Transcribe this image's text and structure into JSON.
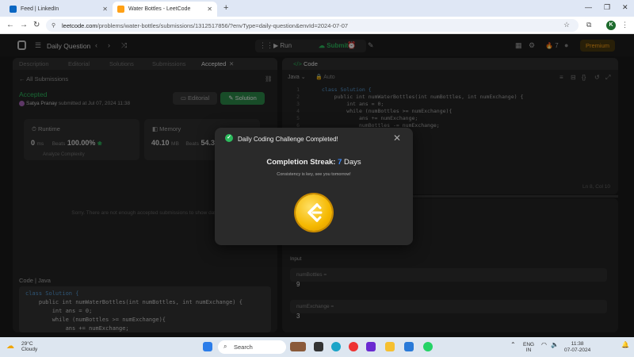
{
  "browser": {
    "tabs": [
      {
        "title": "Feed | LinkedIn",
        "favicon_color": "#0a66c2"
      },
      {
        "title": "Water Bottles - LeetCode",
        "favicon_color": "#ffa116"
      }
    ],
    "url_host": "leetcode.com",
    "url_path": "/problems/water-bottles/submissions/1312517856/?envType=daily-question&envId=2024-07-07",
    "profile_initial": "K"
  },
  "leetcode_nav": {
    "daily_question": "Daily Question",
    "run_label": "Run",
    "submit_label": "Submit",
    "streak_count": "7",
    "premium_label": "Premium"
  },
  "left_panel": {
    "tabs": [
      "Description",
      "Editorial",
      "Solutions",
      "Submissions",
      "Accepted"
    ],
    "all_submissions": "All Submissions",
    "status": "Accepted",
    "submitter": "Satya Pranay",
    "submitted_text": "submitted at Jul 07, 2024 11:38",
    "editorial_btn": "Editorial",
    "solution_btn": "Solution",
    "runtime": {
      "label": "Runtime",
      "value": "0",
      "unit": "ms",
      "beats_label": "Beats",
      "beats_pct": "100.00%"
    },
    "analyze": "Analyze Complexity",
    "memory": {
      "label": "Memory",
      "value": "40.10",
      "unit": "MB",
      "beats_label": "Beats",
      "beats_pct": "54.3"
    },
    "not_enough": "Sorry. There are not enough accepted submissions to show data",
    "code_label": "Code | Java",
    "code_lines": [
      "class Solution {",
      "    public int numWaterBottles(int numBottles, int numExchange) {",
      "        int ans = 0;",
      "        while (numBottles >= numExchange){",
      "            ans += numExchange;"
    ]
  },
  "code_panel": {
    "title": "Code",
    "language": "Java",
    "auto_label": "Auto",
    "lines": [
      "class Solution {",
      "    public int numWaterBottles(int numBottles, int numExchange) {",
      "        int ans = 0;",
      "        while (numBottles >= numExchange){",
      "            ans += numExchange;",
      "            numBottles -= numExchange;"
    ],
    "line_numbers": [
      "1",
      "2",
      "3",
      "4",
      "5",
      "6"
    ],
    "cursor": "Ln 8, Col 10"
  },
  "testcase": {
    "input_label": "Input",
    "params": [
      {
        "name": "numBottles =",
        "value": "9"
      },
      {
        "name": "numExchange =",
        "value": "3"
      }
    ]
  },
  "modal": {
    "title": "Daily Coding Challenge Completed!",
    "streak_label": "Completion Streak:",
    "streak_number": "7",
    "streak_unit": "Days",
    "message": "Consistency is key, see you tomorrow!"
  },
  "taskbar": {
    "temperature": "29°C",
    "condition": "Cloudy",
    "search_placeholder": "Search",
    "lang": "ENG",
    "region": "IN",
    "time": "11:38",
    "date": "07-07-2024"
  }
}
